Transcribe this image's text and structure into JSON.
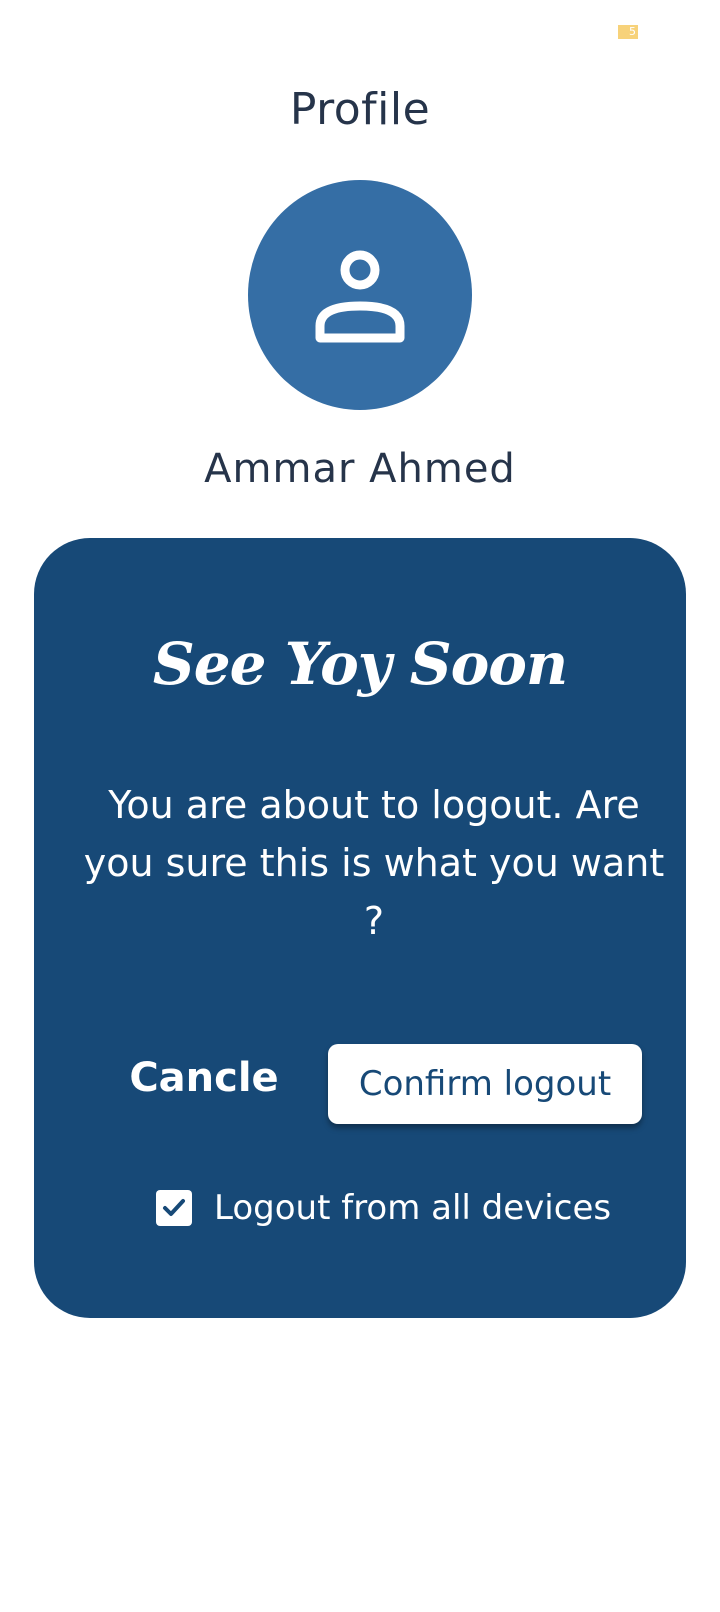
{
  "status_bar": {
    "badge": "5"
  },
  "header": {
    "title": "Profile"
  },
  "profile": {
    "name": "Ammar Ahmed",
    "avatar_icon": "person-icon"
  },
  "dialog": {
    "heading": "See Yoy Soon",
    "message": "You are about to logout. Are you sure this is what you want ?",
    "cancel_label": "Cancle",
    "confirm_label": "Confirm logout",
    "all_devices_label": "Logout from all devices",
    "all_devices_checked": true,
    "background_color": "#174977"
  },
  "colors": {
    "avatar": "#356ea5",
    "text_dark": "#26344a",
    "badge": "#f7d27a"
  }
}
